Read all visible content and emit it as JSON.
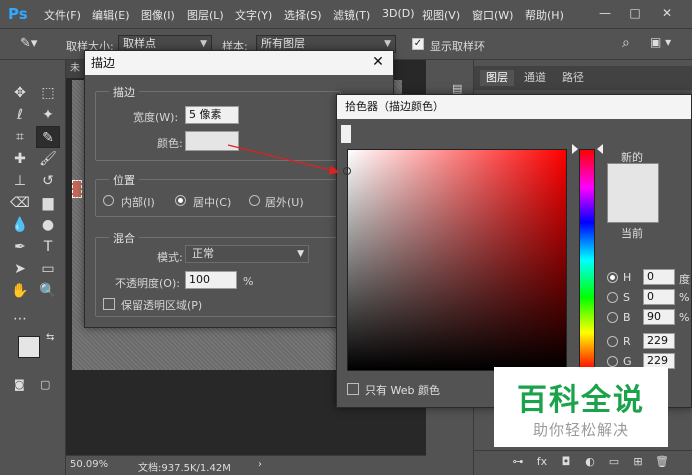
{
  "app": {
    "logo": "Ps"
  },
  "menu": [
    "文件(F)",
    "编辑(E)",
    "图像(I)",
    "图层(L)",
    "文字(Y)",
    "选择(S)",
    "滤镜(T)",
    "3D(D)",
    "视图(V)",
    "窗口(W)",
    "帮助(H)"
  ],
  "window_controls": [
    "—",
    "□",
    "✕"
  ],
  "options_bar": {
    "sample_size_label": "取样大小:",
    "sample_size_value": "取样点",
    "sample_label": "样本:",
    "sample_value": "所有图层",
    "show_ring_label": "显示取样环"
  },
  "document": {
    "tab_label": "未",
    "zoom": "50.09%",
    "doc_size": "文档:937.5K/1.42M"
  },
  "panels": {
    "tabs": [
      "图层",
      "通道",
      "路径"
    ],
    "footer_icons": [
      "link-icon",
      "fx-icon",
      "mask-icon",
      "adjustment-icon",
      "group-icon",
      "new-layer-icon",
      "trash-icon"
    ],
    "footer_glyphs": [
      "⊶",
      "fx",
      "◘",
      "◐",
      "▭",
      "⊞",
      "🗑"
    ]
  },
  "stroke_dialog": {
    "title": "描边",
    "section_stroke": "描边",
    "width_label": "宽度(W):",
    "width_value": "5 像素",
    "color_label": "颜色:",
    "color_value": "#e5e5e5",
    "section_position": "位置",
    "pos_inside": "内部(I)",
    "pos_center": "居中(C)",
    "pos_outside": "居外(U)",
    "section_blend": "混合",
    "mode_label": "模式:",
    "mode_value": "正常",
    "opacity_label": "不透明度(O):",
    "opacity_value": "100",
    "opacity_unit": "%",
    "preserve_label": "保留透明区域(P)"
  },
  "color_picker": {
    "title": "拾色器（描边颜色）",
    "new_label": "新的",
    "current_label": "当前",
    "web_only_label": "只有 Web 颜色",
    "fields": [
      {
        "name": "H",
        "value": "0",
        "unit": "度",
        "selected": true
      },
      {
        "name": "S",
        "value": "0",
        "unit": "%",
        "selected": false
      },
      {
        "name": "B",
        "value": "90",
        "unit": "%",
        "selected": false
      },
      {
        "name": "R",
        "value": "229",
        "unit": "",
        "selected": false
      },
      {
        "name": "G",
        "value": "229",
        "unit": "",
        "selected": false
      }
    ]
  },
  "watermark": {
    "main": "百科全说",
    "sub": "助你轻松解决"
  },
  "colors": {
    "accent": "#31a8ff",
    "foreground": "#e5e5e5",
    "background_swatch": "#c0412b",
    "annotation_arrow": "#e02020",
    "watermark_green": "#1aa34a"
  }
}
